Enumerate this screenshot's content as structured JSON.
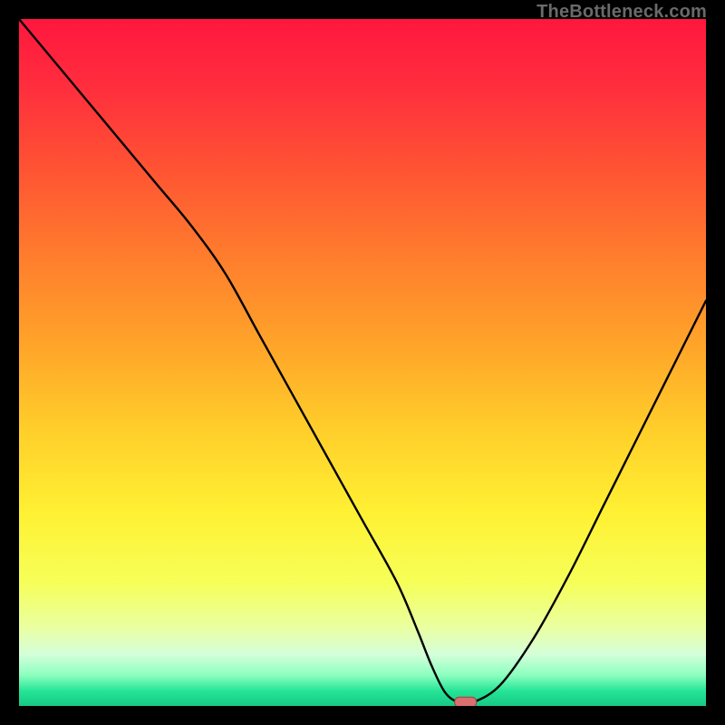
{
  "watermark": "TheBottleneck.com",
  "colors": {
    "frame": "#000000",
    "curve": "#000000",
    "marker_fill": "#d96f6e",
    "marker_stroke": "#97423f",
    "gradient_stops": [
      {
        "offset": 0.0,
        "color": "#ff173e"
      },
      {
        "offset": 0.1,
        "color": "#ff2e3d"
      },
      {
        "offset": 0.22,
        "color": "#ff5433"
      },
      {
        "offset": 0.35,
        "color": "#ff7e2d"
      },
      {
        "offset": 0.48,
        "color": "#ffa629"
      },
      {
        "offset": 0.6,
        "color": "#ffcf2a"
      },
      {
        "offset": 0.72,
        "color": "#fff133"
      },
      {
        "offset": 0.82,
        "color": "#f6ff58"
      },
      {
        "offset": 0.885,
        "color": "#eaffa0"
      },
      {
        "offset": 0.925,
        "color": "#d4ffda"
      },
      {
        "offset": 0.955,
        "color": "#8cffbf"
      },
      {
        "offset": 0.978,
        "color": "#25e597"
      },
      {
        "offset": 1.0,
        "color": "#17c884"
      }
    ]
  },
  "chart_data": {
    "type": "line",
    "title": "",
    "xlabel": "",
    "ylabel": "",
    "xlim": [
      0,
      100
    ],
    "ylim": [
      0,
      100
    ],
    "grid": false,
    "legend": false,
    "series": [
      {
        "name": "bottleneck-curve",
        "x": [
          0,
          5,
          10,
          15,
          20,
          25,
          30,
          35,
          40,
          45,
          50,
          55,
          58,
          60,
          62,
          64,
          66,
          70,
          75,
          80,
          85,
          90,
          95,
          100
        ],
        "y": [
          100,
          94,
          88,
          82,
          76,
          70,
          63,
          54,
          45,
          36,
          27,
          18,
          11,
          6,
          2,
          0.5,
          0.5,
          3,
          10,
          19,
          29,
          39,
          49,
          59
        ]
      }
    ],
    "marker": {
      "x": 65,
      "y": 0.5
    }
  }
}
